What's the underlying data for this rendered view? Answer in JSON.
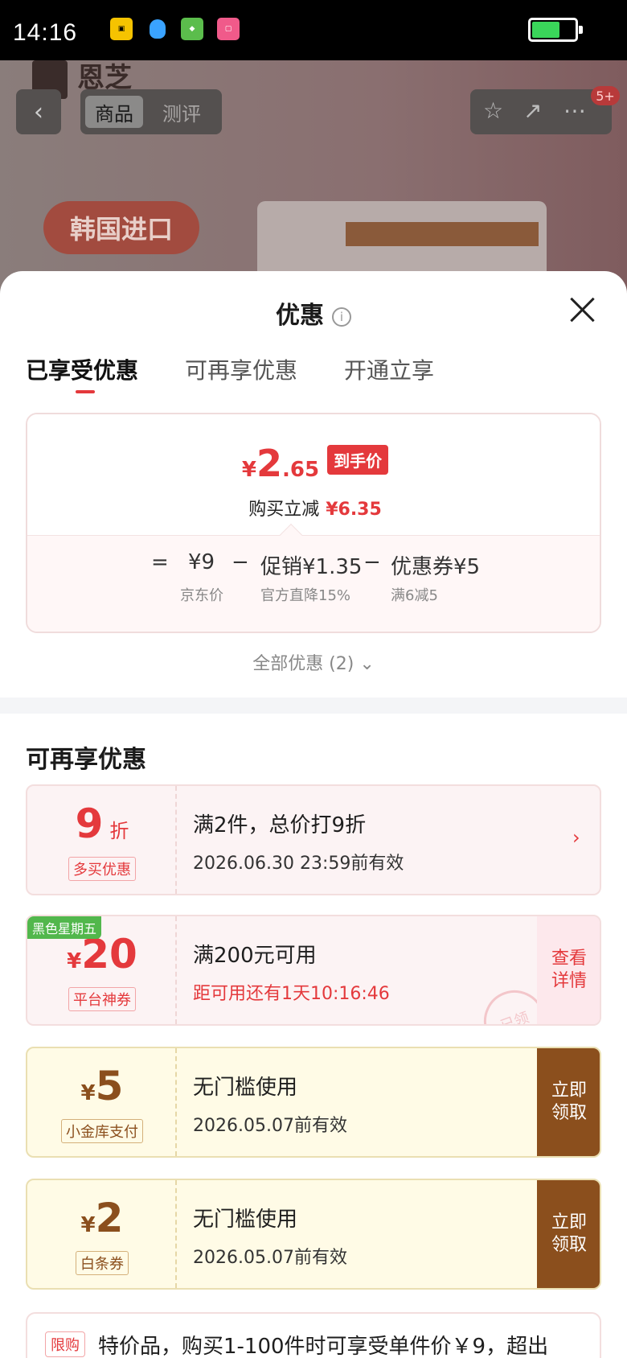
{
  "status_bar": {
    "time": "14:16"
  },
  "background_page": {
    "brand": "恩芝",
    "tabs": [
      "商品",
      "测评"
    ],
    "badge": "5+",
    "promo_pill": "韩国进口"
  },
  "sheet": {
    "title": "优惠",
    "tabs": [
      "已享受优惠",
      "可再享优惠",
      "开通立享"
    ]
  },
  "price_card": {
    "currency": "¥",
    "final_int": "2",
    "final_dec": ".65",
    "final_badge": "到手价",
    "reduce_label": "购买立减",
    "reduce_amount": "¥6.35",
    "calc": {
      "eq": "=",
      "base": "¥9",
      "minus": "−",
      "promo": "促销¥1.35",
      "coupon": "优惠券¥5"
    },
    "calc_sub": {
      "base": "京东价",
      "promo": "官方直降15%",
      "coupon": "满6减5"
    }
  },
  "all_offers": "全部优惠 (2)",
  "section_title": "可再享优惠",
  "coupons": [
    {
      "value": "9",
      "unit": "折",
      "tag": "多买优惠",
      "main": "满2件，总价打9折",
      "sub": "2026.06.30 23:59前有效"
    },
    {
      "ribbon": "黑色星期五",
      "currency": "¥",
      "value": "20",
      "tag": "平台神券",
      "main": "满200元可用",
      "sub": "距可用还有1天10:16:46",
      "side": "查看详情",
      "stamp": "已领"
    },
    {
      "currency": "¥",
      "value": "5",
      "tag": "小金库支付",
      "main": "无门槛使用",
      "sub": "2026.05.07前有效",
      "side": "立即领取"
    },
    {
      "currency": "¥",
      "value": "2",
      "tag": "白条券",
      "main": "无门槛使用",
      "sub": "2026.05.07前有效",
      "side": "立即领取"
    }
  ],
  "limit": {
    "tag": "限购",
    "text": "特价品，购买1-100件时可享受单件价￥9，超出"
  },
  "colors": {
    "accent": "#e4393c",
    "gold_button": "#8b4f1d",
    "ribbon_green": "#52b74c"
  }
}
